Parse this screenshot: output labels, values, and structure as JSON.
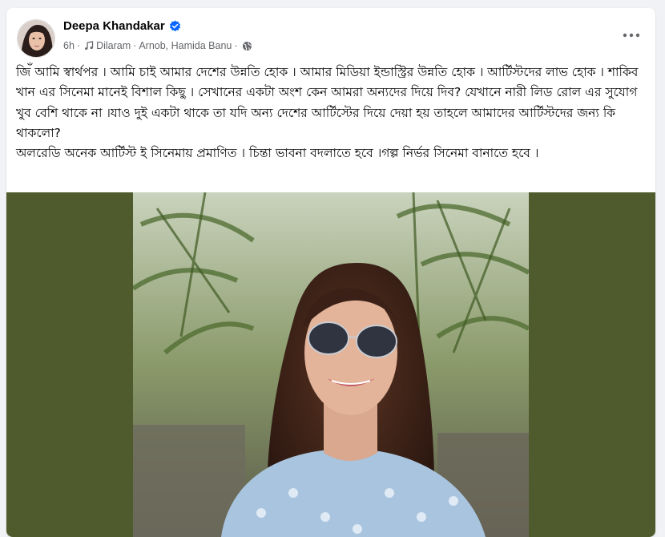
{
  "post": {
    "author": "Deepa Khandakar",
    "time": "6h",
    "music": "Dilaram",
    "artists": "Arnob, Hamida Banu",
    "paragraph1": "জিঁ আমি স্বার্থপর । আমি চাই আমার দেশের উন্নতি হোক । আমার মিডিয়া ইন্ডাস্ট্রির উন্নতি হোক । আর্টিস্টদের লাভ হোক । শাকিব খান এর সিনেমা মানেই বিশাল কিছু । সেখানের একটা অংশ কেন আমরা অন্যদের দিয়ে দিব? যেখানে নারী লিড রোল এর সুযোগ খুব বেশি থাকে না ।যাও দুই একটা থাকে তা যদি অন্য দেশের আর্টিস্টের দিয়ে দেয়া হয় তাহলে আমাদের আর্টিস্টদের জন্য কি থাকলো?",
    "paragraph2": "অলরেডি অনেক আর্টিস্ট ই সিনেমায় প্রমাণিত । চিন্তা ভাবনা বদলাতে হবে ।গল্প নির্ভর সিনেমা বানাতে হবে ।"
  },
  "icons": {
    "verified": "verified-badge-icon",
    "music": "music-note-icon",
    "privacy": "globe-icon",
    "more": "more-options-icon"
  },
  "colors": {
    "verified_blue": "#0866ff",
    "secondary_text": "#65676b",
    "media_background": "#4f5b2c"
  }
}
